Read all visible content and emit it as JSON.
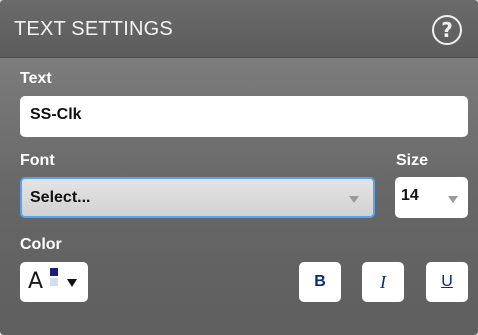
{
  "dialog": {
    "title": "TEXT SETTINGS",
    "help_symbol": "?"
  },
  "text_field": {
    "label": "Text",
    "value": "SS-Clk"
  },
  "font": {
    "label": "Font",
    "selected": "Select..."
  },
  "size": {
    "label": "Size",
    "selected": "14"
  },
  "color": {
    "label": "Color",
    "glyph": "A",
    "foreground": "#1a1f7a",
    "background": "#d4dcf0"
  },
  "style_buttons": {
    "bold": "B",
    "italic": "I",
    "underline": "U"
  },
  "colors": {
    "focus_border": "#5aa4e6",
    "button_text": "#0a2a78"
  }
}
